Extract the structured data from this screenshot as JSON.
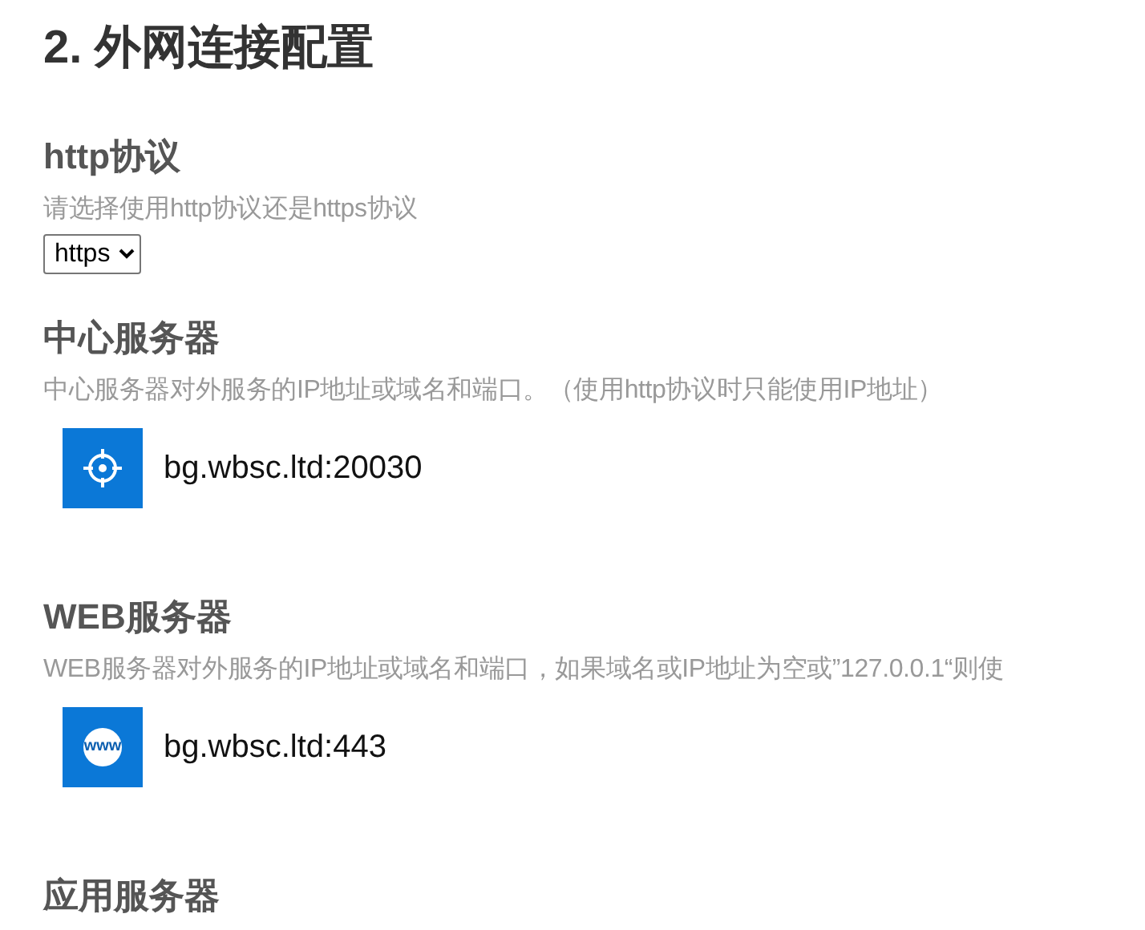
{
  "title": "2. 外网连接配置",
  "sections": [
    {
      "kind": "select",
      "heading": "http协议",
      "description": "请选择使用http协议还是https协议",
      "value": "https"
    },
    {
      "kind": "address",
      "heading": "中心服务器",
      "description": "中心服务器对外服务的IP地址或域名和端口。（使用http协议时只能使用IP地址）",
      "address": "bg.wbsc.ltd:20030"
    },
    {
      "kind": "address",
      "heading": "WEB服务器",
      "description": "WEB服务器对外服务的IP地址或域名和端口，如果域名或IP地址为空或”127.0.0.1“则使",
      "icon_text": "www",
      "address": "bg.wbsc.ltd:443"
    },
    {
      "kind": "heading",
      "heading": "应用服务器"
    }
  ]
}
